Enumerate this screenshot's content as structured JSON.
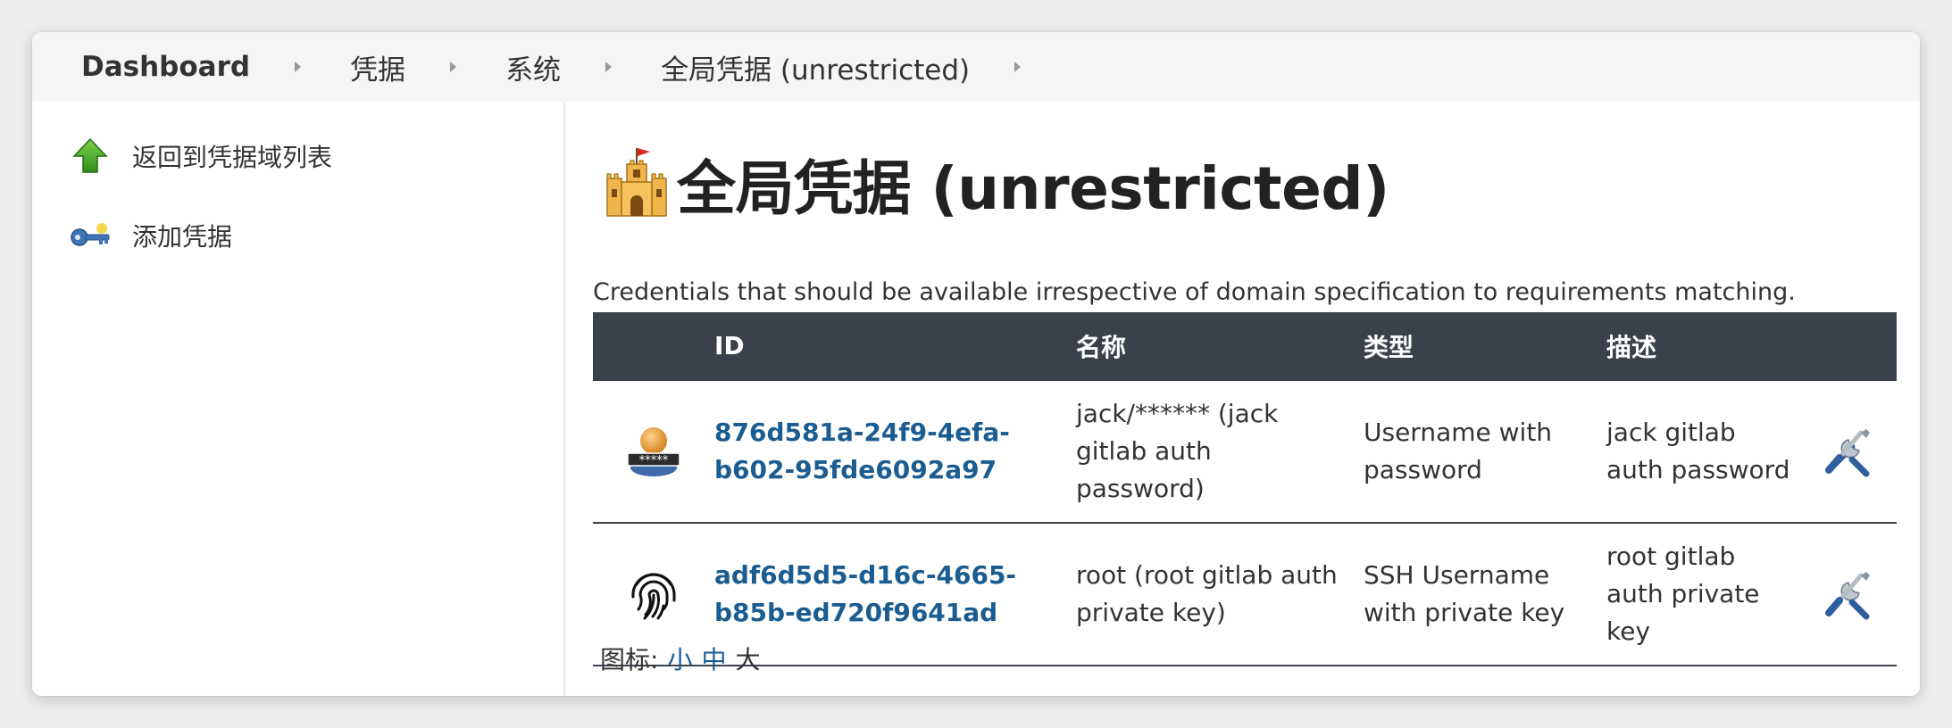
{
  "breadcrumb": {
    "items": [
      {
        "label": "Dashboard"
      },
      {
        "label": "凭据"
      },
      {
        "label": "系统"
      },
      {
        "label": "全局凭据 (unrestricted)"
      }
    ]
  },
  "sidebar": {
    "items": [
      {
        "label": "返回到凭据域列表",
        "icon": "up-arrow-icon"
      },
      {
        "label": "添加凭据",
        "icon": "key-icon"
      }
    ]
  },
  "main": {
    "title": "全局凭据 (unrestricted)",
    "title_icon": "castle-icon",
    "description": "Credentials that should be available irrespective of domain specification to requirements matching.",
    "table": {
      "headers": [
        "",
        "ID",
        "名称",
        "类型",
        "描述",
        ""
      ],
      "rows": [
        {
          "icon": "user-password-icon",
          "id_line1": "876d581a-24f9-4efa-",
          "id_line2": "b602-95fde6092a97",
          "name_line1": "jack/****** (jack",
          "name_line2": "gitlab auth",
          "name_line3": "password)",
          "type_line1": "Username with",
          "type_line2": "password",
          "desc_line1": "jack gitlab",
          "desc_line2": "auth password",
          "action_icon": "wrench-screwdriver-icon"
        },
        {
          "icon": "fingerprint-icon",
          "id_line1": "adf6d5d5-d16c-4665-",
          "id_line2": "b85b-ed720f9641ad",
          "name_line1": "root (root gitlab auth",
          "name_line2": "private key)",
          "type_line1": "SSH Username",
          "type_line2": "with private key",
          "desc_line1": "root gitlab",
          "desc_line2": "auth private",
          "desc_line3": "key",
          "action_icon": "wrench-screwdriver-icon"
        }
      ]
    },
    "icon_size": {
      "label": "图标:",
      "small": "小",
      "medium": "中",
      "large": "大"
    }
  },
  "colors": {
    "table_header_bg": "#3a414b",
    "link": "#1b5c91",
    "breadcrumb_bg": "#f5f5f5"
  }
}
